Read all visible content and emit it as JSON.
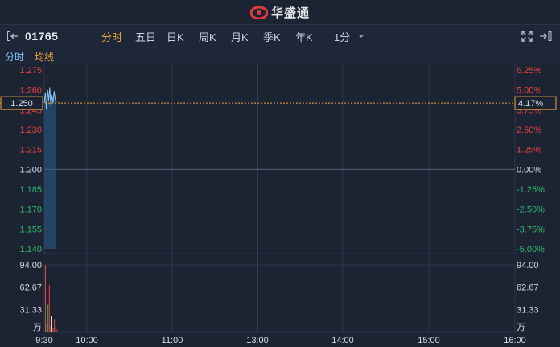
{
  "brand": {
    "name": "华盛通"
  },
  "toolbar": {
    "stock_code": "01765",
    "tabs": [
      "分时",
      "五日",
      "日K",
      "周K",
      "月K",
      "季K",
      "年K"
    ],
    "interval": "1分"
  },
  "legend": {
    "intraday": "分时",
    "average": "均线"
  },
  "price_axis": {
    "left_ticks": [
      "1.275",
      "1.260",
      "1.245",
      "1.230",
      "1.215",
      "1.200",
      "1.185",
      "1.170",
      "1.155",
      "1.140"
    ],
    "right_ticks": [
      "6.25%",
      "5.00%",
      "3.75%",
      "2.50%",
      "1.25%",
      "0.00%",
      "-1.25%",
      "-2.50%",
      "-3.75%",
      "-5.00%"
    ],
    "crosshair_price": "1.250",
    "crosshair_pct": "4.17%"
  },
  "volume_axis": {
    "ticks": [
      "94.00",
      "62.67",
      "31.33"
    ],
    "unit": "万"
  },
  "time_axis": [
    "9:30",
    "10:00",
    "11:00",
    "13:00",
    "14:00",
    "15:00",
    "16:00"
  ],
  "colors": {
    "up": "#e8413c",
    "down": "#2fb86b",
    "neutral": "#d8dde5",
    "price_line": "#8cc7f2",
    "accent": "#f0a43a"
  },
  "chart_data": {
    "type": "line",
    "prev_close": 1.2,
    "ylim": [
      1.14,
      1.275
    ],
    "price_series": [
      1.25,
      1.258,
      1.245,
      1.26,
      1.252,
      1.262,
      1.248,
      1.256,
      1.25,
      1.259,
      1.253,
      1.25
    ],
    "volume_ylim": [
      0,
      94
    ],
    "volume_bars": [
      94,
      12,
      38,
      66,
      8,
      22,
      5,
      18,
      6,
      3
    ],
    "volume_colors": [
      "up",
      "up",
      "down",
      "up",
      "up",
      "neutral",
      "up",
      "up",
      "down",
      "up"
    ]
  }
}
